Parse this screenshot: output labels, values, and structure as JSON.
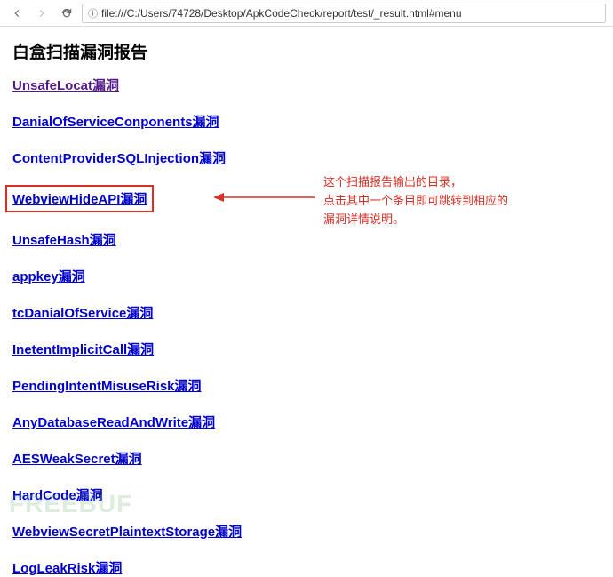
{
  "toolbar": {
    "url": "file:///C:/Users/74728/Desktop/ApkCodeCheck/report/test/_result.html#menu"
  },
  "page": {
    "title": "白盒扫描漏洞报告"
  },
  "links": [
    {
      "label": "UnsafeLocat漏洞",
      "visited": true,
      "highlighted": false
    },
    {
      "label": "DanialOfServiceConponents漏洞",
      "visited": false,
      "highlighted": false
    },
    {
      "label": "ContentProviderSQLInjection漏洞",
      "visited": false,
      "highlighted": false
    },
    {
      "label": "WebviewHideAPI漏洞",
      "visited": false,
      "highlighted": true
    },
    {
      "label": "UnsafeHash漏洞",
      "visited": false,
      "highlighted": false
    },
    {
      "label": "appkey漏洞",
      "visited": false,
      "highlighted": false
    },
    {
      "label": "tcDanialOfService漏洞",
      "visited": false,
      "highlighted": false
    },
    {
      "label": "InetentImplicitCall漏洞",
      "visited": false,
      "highlighted": false
    },
    {
      "label": "PendingIntentMisuseRisk漏洞",
      "visited": false,
      "highlighted": false
    },
    {
      "label": "AnyDatabaseReadAndWrite漏洞",
      "visited": false,
      "highlighted": false
    },
    {
      "label": "AESWeakSecret漏洞",
      "visited": false,
      "highlighted": false
    },
    {
      "label": "HardCode漏洞",
      "visited": false,
      "highlighted": false
    },
    {
      "label": "WebviewSecretPlaintextStorage漏洞",
      "visited": false,
      "highlighted": false
    },
    {
      "label": "LogLeakRisk漏洞",
      "visited": false,
      "highlighted": false
    }
  ],
  "annotation": {
    "line1": "这个扫描报告输出的目录，",
    "line2": "点击其中一个条目即可跳转到相应的",
    "line3": "漏洞详情说明。"
  },
  "watermark": "FREEBUF"
}
